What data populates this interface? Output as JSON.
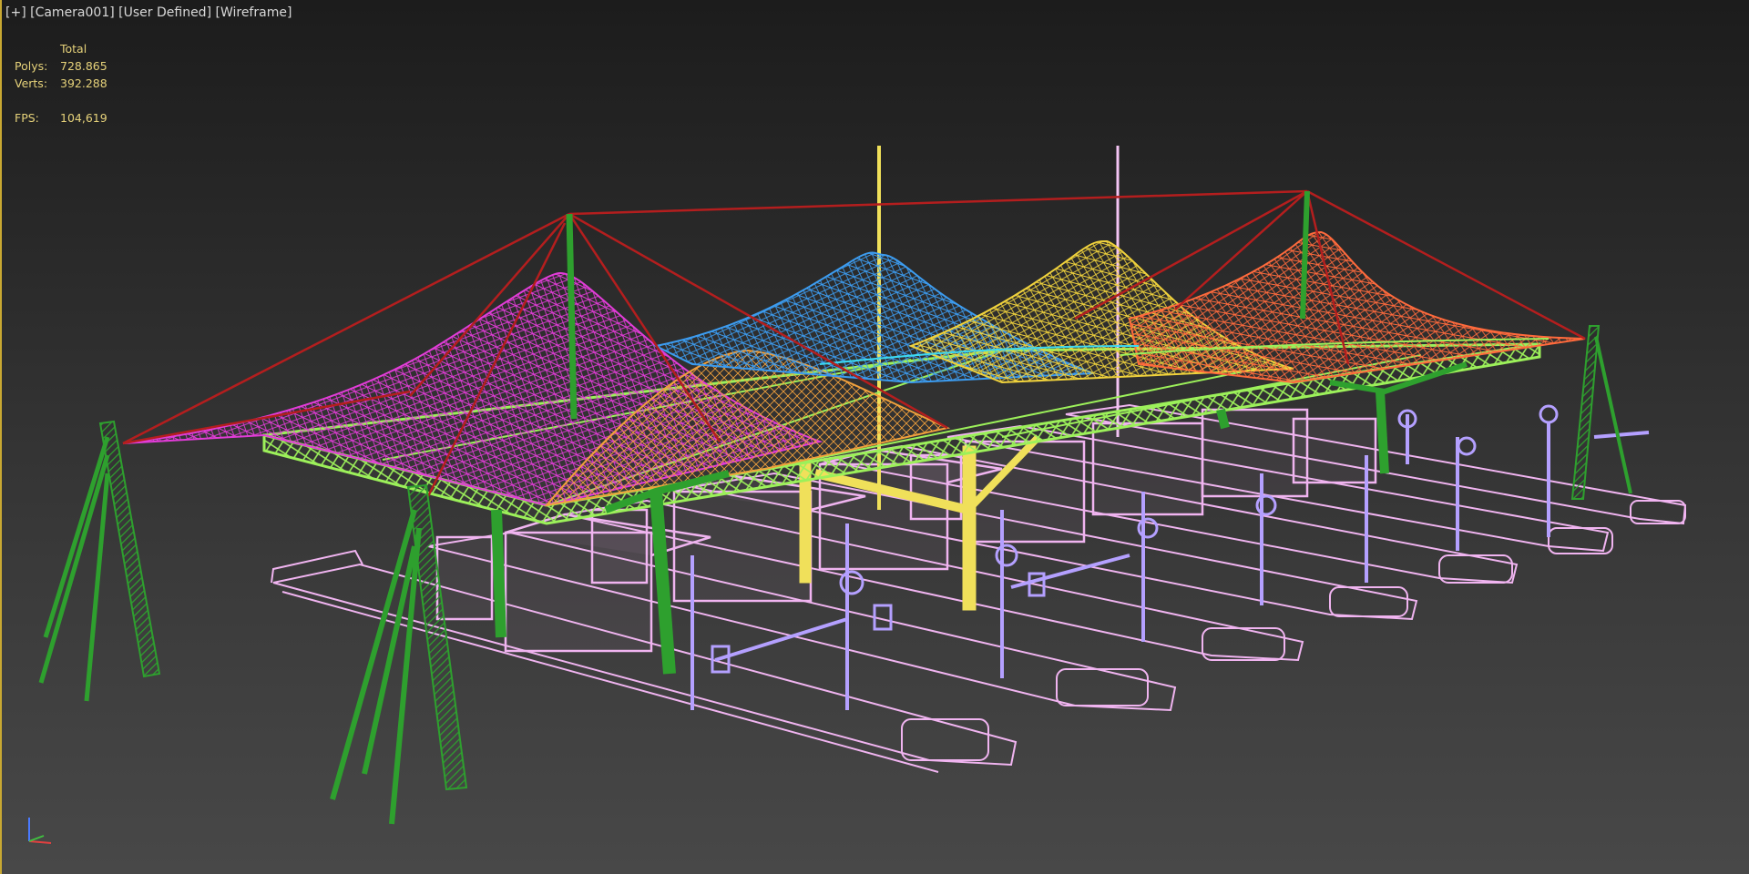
{
  "viewport": {
    "label": {
      "plus": "[+]",
      "camera": "[Camera001]",
      "shading_mode": "[User Defined]",
      "render_mode": "[Wireframe]"
    },
    "stats": {
      "header": "Total",
      "polys_label": "Polys:",
      "polys_value": "728.865",
      "verts_label": "Verts:",
      "verts_value": "392.288",
      "fps_label": "FPS:",
      "fps_value": "104,619"
    }
  },
  "colors": {
    "active_viewport_border": "#c8a832",
    "stats_text": "#e6d27a",
    "label_text": "#d8d8d8",
    "membrane_magenta": "#e23cd8",
    "membrane_blue": "#3c9cf0",
    "membrane_yellow": "#f0d23c",
    "membrane_red": "#ff5a3c",
    "steel_truss": "#9cf05a",
    "columns": "#2ea02e",
    "cables": "#b41e1e",
    "masts": "#f0e05a",
    "booths": "#f0b4f0",
    "barriers": "#b4a0ff"
  },
  "icons": {
    "axis_gizmo": "axis-tripod-icon"
  }
}
